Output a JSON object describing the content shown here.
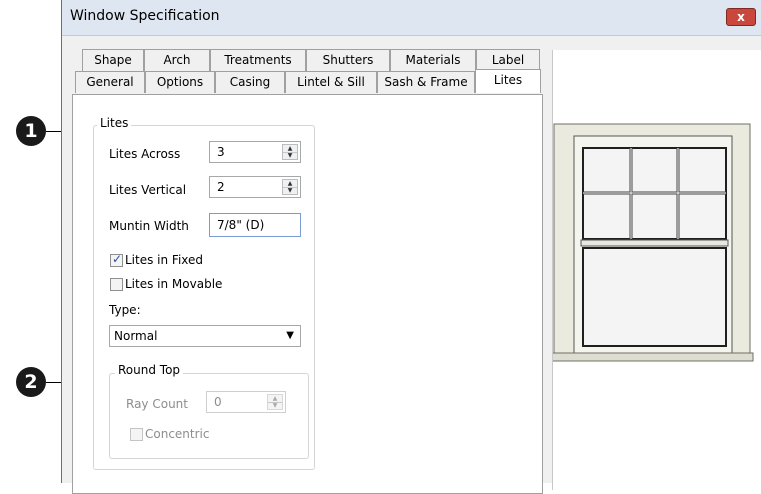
{
  "callouts": {
    "first": "1",
    "second": "2"
  },
  "window": {
    "title": "Window Specification",
    "close_glyph": "x"
  },
  "tabs_row1": [
    "Shape",
    "Arch",
    "Treatments",
    "Shutters",
    "Materials",
    "Label"
  ],
  "tabs_row2": [
    "General",
    "Options",
    "Casing",
    "Lintel & Sill",
    "Sash & Frame",
    "Lites"
  ],
  "lites_group": {
    "legend": "Lites",
    "lites_across_label": "Lites Across",
    "lites_across_value": "3",
    "lites_vertical_label": "Lites Vertical",
    "lites_vertical_value": "2",
    "muntin_width_label": "Muntin Width",
    "muntin_width_value": "7/8\" (D)",
    "lites_in_fixed_label": "Lites in Fixed",
    "lites_in_fixed_checked": true,
    "lites_in_movable_label": "Lites in Movable",
    "lites_in_movable_checked": false,
    "type_label": "Type:",
    "type_value": "Normal"
  },
  "round_top_group": {
    "legend": "Round Top",
    "ray_count_label": "Ray Count",
    "ray_count_value": "0",
    "concentric_label": "Concentric",
    "concentric_checked": false
  },
  "icons": {
    "checkmark": "checkmark-icon",
    "spin_up": "spin-up-icon",
    "spin_down": "spin-down-icon",
    "dropdown": "chevron-down-icon"
  },
  "colors": {
    "titlebar": "#dde6f1",
    "close": "#c9473c",
    "preview_frame": "#eaeadf"
  }
}
